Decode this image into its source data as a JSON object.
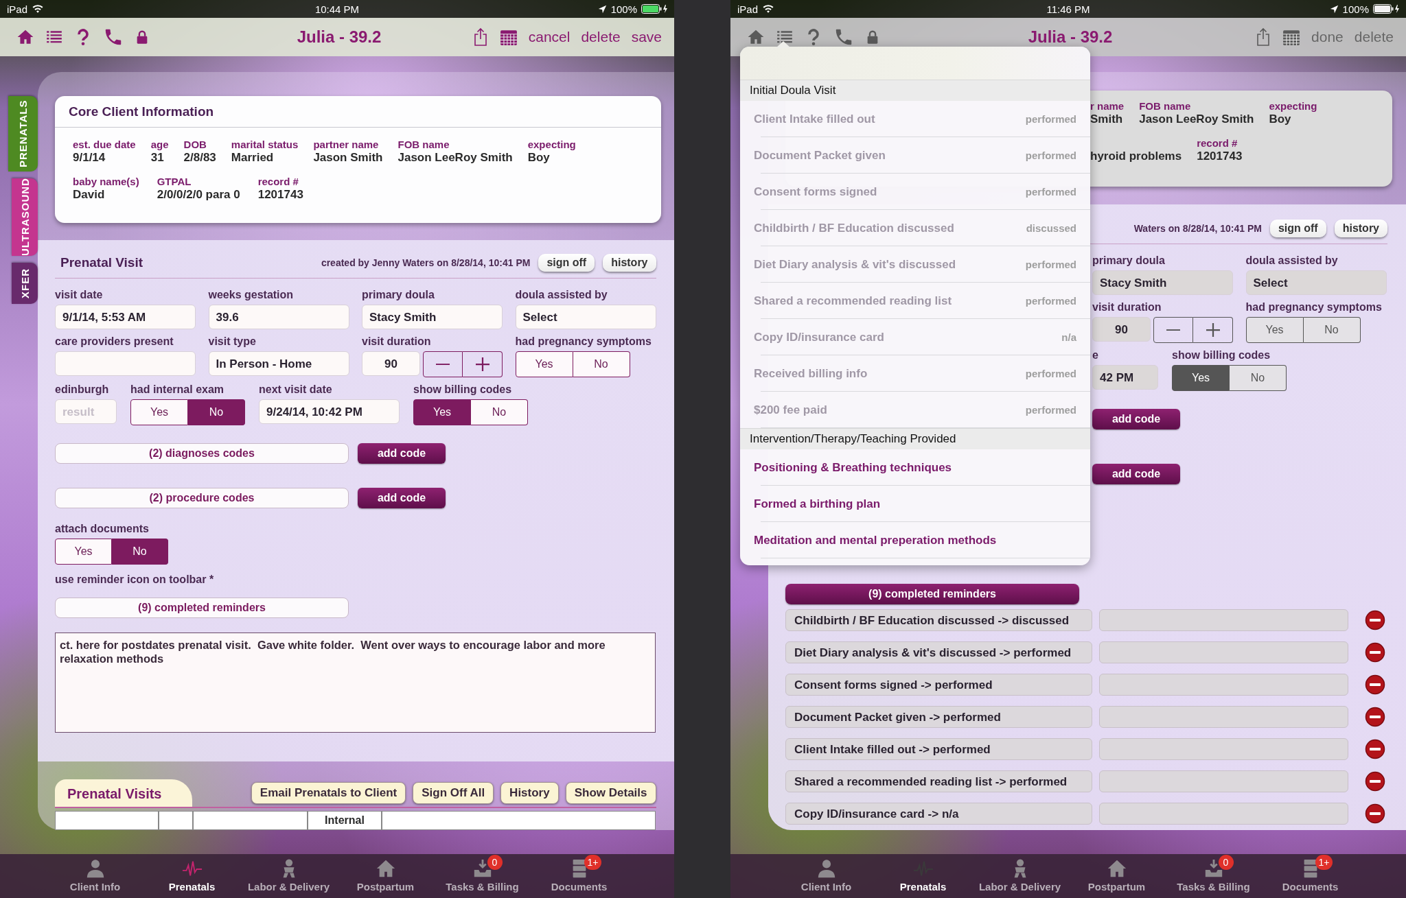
{
  "screens": [
    {
      "dimmed": false,
      "status_bar": {
        "carrier": "iPad",
        "time": "10:44 PM",
        "battery": "100%"
      },
      "nav_bar": {
        "title": "Julia - 39.2",
        "actions": [
          "cancel",
          "delete",
          "save"
        ]
      },
      "side_tabs": [
        {
          "label": "PRENATALS",
          "color": "#4e8a22",
          "selected": true
        },
        {
          "label": "ULTRASOUND",
          "color": "#c4358f",
          "selected": false
        },
        {
          "label": "XFER",
          "color": "#682a6c",
          "selected": false
        }
      ],
      "core_client": {
        "title": "Core Client Information",
        "lines": [
          {
            "fields": [
              {
                "label": "est. due date",
                "value": "9/1/14"
              },
              {
                "label": "age",
                "value": "31"
              },
              {
                "label": "DOB",
                "value": "2/8/83"
              },
              {
                "label": "marital status",
                "value": "Married"
              },
              {
                "label": "partner name",
                "value": "Jason Smith"
              },
              {
                "label": "FOB name",
                "value": "Jason LeeRoy Smith"
              },
              {
                "label": "expecting",
                "value": "Boy"
              }
            ]
          },
          {
            "fields": [
              {
                "label": "baby name(s)",
                "value": "David"
              },
              {
                "label": "GTPAL",
                "value": "2/0/0/2/0 para 0"
              },
              {
                "label": "record #",
                "value": "1201743"
              }
            ]
          }
        ]
      },
      "prenatal_visit": {
        "title": "Prenatal Visit",
        "meta": "created by Jenny Waters on 8/28/14, 10:41 PM",
        "buttons": [
          "sign off",
          "history"
        ],
        "field_rows": [
          [
            {
              "kind": "text",
              "label": "visit date",
              "value": "9/1/14, 5:53 AM"
            },
            {
              "kind": "text",
              "label": "weeks gestation",
              "value": "39.6"
            },
            {
              "kind": "text",
              "label": "primary doula",
              "value": "Stacy Smith"
            },
            {
              "kind": "text",
              "label": "doula assisted by",
              "value": "Select"
            }
          ],
          [
            {
              "kind": "text",
              "label": "care providers present"
            },
            {
              "kind": "text",
              "label": "visit type",
              "value": "In Person - Home"
            },
            {
              "kind": "stepper",
              "label": "visit duration",
              "value": "90"
            },
            {
              "kind": "segmented",
              "label": "had pregnancy symptoms",
              "options": [
                {
                  "label": "Yes",
                  "selected": false
                },
                {
                  "label": "No",
                  "selected": false
                }
              ]
            }
          ],
          [
            {
              "kind": "mini_text",
              "label": "edinburgh",
              "placeholder": "result"
            },
            {
              "kind": "segmented",
              "label": "had internal exam",
              "options": [
                {
                  "label": "Yes",
                  "selected": false
                },
                {
                  "label": "No",
                  "selected": true
                }
              ]
            },
            {
              "kind": "text",
              "label": "next visit date",
              "value": "9/24/14, 10:42 PM"
            },
            {
              "kind": "segmented",
              "label": "show billing codes",
              "options": [
                {
                  "label": "Yes",
                  "selected": true
                },
                {
                  "label": "No",
                  "selected": false
                }
              ]
            }
          ]
        ],
        "code_rows": [
          {
            "label": "(2) diagnoses codes",
            "button": "add code"
          },
          {
            "label": "(2) procedure codes",
            "button": "add code"
          }
        ],
        "attach_documents": {
          "label": "attach documents",
          "options": [
            {
              "label": "Yes",
              "selected": false
            },
            {
              "label": "No",
              "selected": true
            }
          ]
        },
        "reminder_note": "use reminder icon on toolbar *",
        "reminders_button": "(9) completed reminders",
        "notes": "ct. here for postdates prenatal visit.  Gave white folder.  Went over ways to encourage labor and more relaxation methods"
      },
      "prenatal_visits": {
        "title": "Prenatal Visits",
        "buttons": [
          "Email Prenatals to Client",
          "Sign Off All",
          "History",
          "Show Details"
        ],
        "columns": [
          {
            "kind": "blank"
          },
          {
            "kind": "blank"
          },
          {
            "kind": "blank"
          },
          {
            "kind": "text",
            "label": "Internal"
          },
          {
            "kind": "blank"
          }
        ]
      },
      "tab_bar": [
        {
          "label": "Client Info",
          "selected": false
        },
        {
          "label": "Prenatals",
          "selected": true
        },
        {
          "label": "Labor & Delivery",
          "selected": false
        },
        {
          "label": "Postpartum",
          "selected": false
        },
        {
          "label": "Tasks & Billing",
          "selected": false,
          "badge": "0"
        },
        {
          "label": "Documents",
          "selected": false,
          "badge": "1+"
        }
      ]
    },
    {
      "dimmed": true,
      "status_bar": {
        "carrier": "iPad",
        "time": "11:46 PM",
        "battery": "100%"
      },
      "nav_bar": {
        "title": "Julia - 39.2",
        "actions": [
          "done",
          "delete"
        ]
      },
      "popover": {
        "sections": [
          {
            "title": "Initial Doula Visit",
            "items": [
              {
                "label": "Client Intake filled out",
                "status": "performed",
                "disabled": true
              },
              {
                "label": "Document Packet given",
                "status": "performed",
                "disabled": true
              },
              {
                "label": "Consent forms signed",
                "status": "performed",
                "disabled": true
              },
              {
                "label": "Childbirth / BF Education discussed",
                "status": "discussed",
                "disabled": true
              },
              {
                "label": "Diet Diary analysis & vit's discussed",
                "status": "performed",
                "disabled": true
              },
              {
                "label": "Shared a recommended reading list",
                "status": "performed",
                "disabled": true
              },
              {
                "label": "Copy ID/insurance card",
                "status": "n/a",
                "disabled": true
              },
              {
                "label": "Received billing info",
                "status": "performed",
                "disabled": true
              },
              {
                "label": "$200 fee paid",
                "status": "performed",
                "disabled": true
              }
            ]
          },
          {
            "title": "Intervention/Therapy/Teaching Provided",
            "items": [
              {
                "label": "Positioning & Breathing techniques",
                "disabled": false
              },
              {
                "label": "Formed a birthing plan",
                "disabled": false
              },
              {
                "label": "Meditation and mental preperation methods",
                "disabled": false
              }
            ]
          }
        ]
      },
      "core_client": {
        "lines": [
          {
            "fields": [
              {
                "label": "r name",
                "value": "Smith"
              },
              {
                "label": "FOB name",
                "value": "Jason LeeRoy Smith"
              },
              {
                "label": "expecting",
                "value": "Boy"
              }
            ]
          },
          {
            "fields": [
              {
                "value": "hyroid problems"
              },
              {
                "label": "record #",
                "value": "1201743"
              }
            ]
          }
        ]
      },
      "prenatal_visit": {
        "meta": "Waters on 8/28/14, 10:41 PM",
        "buttons": [
          "sign off",
          "history"
        ],
        "field_rows": [
          [
            {
              "kind": "text",
              "label": "primary doula",
              "value": "Stacy Smith"
            },
            {
              "kind": "text",
              "label": "doula assisted by",
              "value": "Select"
            }
          ],
          [
            {
              "kind": "stepper",
              "label": "visit duration",
              "value": "90"
            },
            {
              "kind": "segmented",
              "label": "had pregnancy symptoms",
              "options": [
                {
                  "label": "Yes",
                  "selected": false
                },
                {
                  "label": "No",
                  "selected": false
                }
              ]
            }
          ],
          [
            {
              "kind": "cut_text",
              "label": "e",
              "value": "42 PM"
            },
            {
              "kind": "segmented",
              "label": "show billing codes",
              "options": [
                {
                  "label": "Yes",
                  "selected": true
                },
                {
                  "label": "No",
                  "selected": false
                }
              ]
            }
          ]
        ],
        "code_rows": [
          {
            "button": "add code"
          },
          {
            "button": "add code"
          }
        ],
        "reminders_button": "(9) completed reminders",
        "completed_reminders": [
          {
            "label": "Childbirth / BF Education discussed -> discussed"
          },
          {
            "label": "Diet Diary analysis & vit's discussed -> performed"
          },
          {
            "label": "Consent forms signed -> performed"
          },
          {
            "label": "Document Packet given -> performed"
          },
          {
            "label": "Client Intake filled out -> performed"
          },
          {
            "label": "Shared a recommended reading list -> performed"
          },
          {
            "label": "Copy ID/insurance card -> n/a"
          }
        ]
      },
      "tab_bar": [
        {
          "label": "Client Info",
          "selected": false
        },
        {
          "label": "Prenatals",
          "selected": true
        },
        {
          "label": "Labor & Delivery",
          "selected": false
        },
        {
          "label": "Postpartum",
          "selected": false
        },
        {
          "label": "Tasks & Billing",
          "selected": false,
          "badge": "0"
        },
        {
          "label": "Documents",
          "selected": false,
          "badge": "1+"
        }
      ]
    }
  ]
}
